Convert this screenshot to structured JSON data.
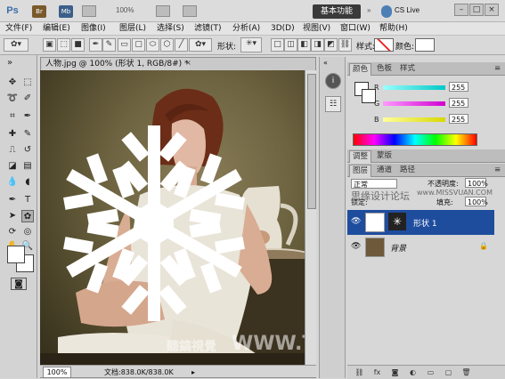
{
  "titlebar": {
    "app_logo": "Ps",
    "bridge_label": "Br",
    "minibridge_label": "Mb",
    "zoom": "100%",
    "workspace": "基本功能",
    "cslive": "CS Live",
    "cslive_icon": "cs-live-icon"
  },
  "menu": {
    "items": [
      "文件(F)",
      "编辑(E)",
      "图像(I)",
      "图层(L)",
      "选择(S)",
      "滤镜(T)",
      "分析(A)",
      "3D(D)",
      "视图(V)",
      "窗口(W)",
      "帮助(H)"
    ]
  },
  "options": {
    "shape_label": "形状:",
    "style_label": "样式:",
    "color_label": "颜色:"
  },
  "document": {
    "tab_title": "人物.jpg @ 100% (形状 1, RGB/8#) *",
    "zoom": "100%",
    "info": "文档:838.0K/838.0K"
  },
  "panels": {
    "color_tabs": [
      "颜色",
      "色板",
      "样式"
    ],
    "sliders": [
      {
        "label": "R",
        "value": "255",
        "color": "#00c8c8"
      },
      {
        "label": "G",
        "value": "255",
        "color": "#d100d1"
      },
      {
        "label": "B",
        "value": "255",
        "color": "#d8d800"
      }
    ],
    "adjust_tabs": [
      "调整",
      "蒙版"
    ],
    "layers_tabs": [
      "图层",
      "通道",
      "路径"
    ],
    "blend_mode": "正常",
    "opacity_label": "不透明度:",
    "opacity_value": "100%",
    "lock_label": "锁定:",
    "fill_label": "填充:",
    "fill_value": "100%",
    "layers": [
      {
        "name": "形状 1",
        "selected": true
      },
      {
        "name": "背景",
        "selected": false
      }
    ]
  },
  "watermarks": {
    "site_cn": "思缘设计论坛",
    "site_url": "www.MISSVUAN.COM",
    "brand": "聽鎬視覺",
    "brand_url": "WWW.TLVI.NET"
  },
  "colors": {
    "selection_blue": "#1f4d9e",
    "workspace_bg": "#3a3a3a"
  }
}
